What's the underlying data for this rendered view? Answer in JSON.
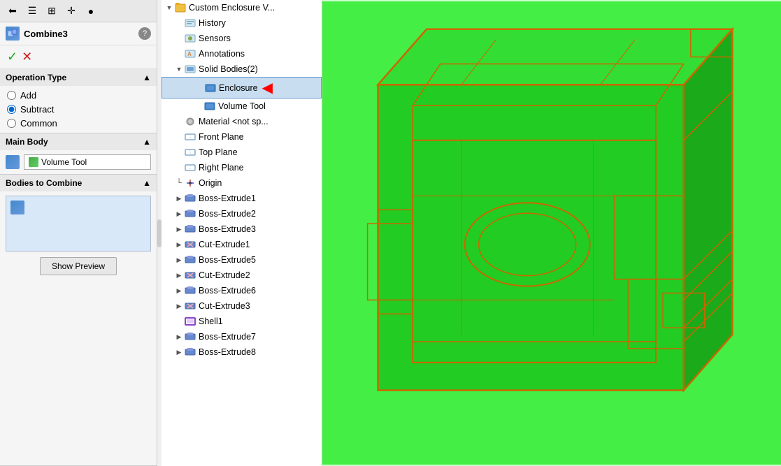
{
  "leftPanel": {
    "toolbar": {
      "buttons": [
        "⬅",
        "☰",
        "⊞",
        "✛",
        "🎨"
      ]
    },
    "combine": {
      "title": "Combine3",
      "help_label": "?",
      "confirm_label": "✓",
      "cancel_label": "✕"
    },
    "operationType": {
      "title": "Operation Type",
      "options": [
        "Add",
        "Subtract",
        "Common"
      ],
      "selected": "Subtract"
    },
    "mainBody": {
      "title": "Main Body",
      "value": "Volume Tool"
    },
    "bodiesToCombine": {
      "title": "Bodies to Combine"
    },
    "showPreview": {
      "label": "Show Preview"
    }
  },
  "tree": {
    "root": "Custom Enclosure V...",
    "items": [
      {
        "id": "history",
        "label": "History",
        "indent": 1,
        "expandable": false,
        "icon": "folder"
      },
      {
        "id": "sensors",
        "label": "Sensors",
        "indent": 1,
        "expandable": false,
        "icon": "sensor"
      },
      {
        "id": "annotations",
        "label": "Annotations",
        "indent": 1,
        "expandable": false,
        "icon": "annotation"
      },
      {
        "id": "solidBodies",
        "label": "Solid Bodies(2)",
        "indent": 1,
        "expandable": true,
        "expanded": true,
        "icon": "folder"
      },
      {
        "id": "enclosure",
        "label": "Enclosure",
        "indent": 2,
        "expandable": false,
        "icon": "body",
        "highlighted": true,
        "hasArrow": true
      },
      {
        "id": "volumeTool",
        "label": "Volume Tool",
        "indent": 2,
        "expandable": false,
        "icon": "body"
      },
      {
        "id": "material",
        "label": "Material <not sp...",
        "indent": 1,
        "expandable": false,
        "icon": "material"
      },
      {
        "id": "frontPlane",
        "label": "Front Plane",
        "indent": 1,
        "expandable": false,
        "icon": "plane"
      },
      {
        "id": "topPlane",
        "label": "Top Plane",
        "indent": 1,
        "expandable": false,
        "icon": "plane"
      },
      {
        "id": "rightPlane",
        "label": "Right Plane",
        "indent": 1,
        "expandable": false,
        "icon": "plane"
      },
      {
        "id": "origin",
        "label": "Origin",
        "indent": 1,
        "expandable": false,
        "icon": "origin"
      },
      {
        "id": "bossExtrude1",
        "label": "Boss-Extrude1",
        "indent": 1,
        "expandable": true,
        "icon": "feature"
      },
      {
        "id": "bossExtrude2",
        "label": "Boss-Extrude2",
        "indent": 1,
        "expandable": true,
        "icon": "feature"
      },
      {
        "id": "bossExtrude3",
        "label": "Boss-Extrude3",
        "indent": 1,
        "expandable": true,
        "icon": "feature"
      },
      {
        "id": "cutExtrude1",
        "label": "Cut-Extrude1",
        "indent": 1,
        "expandable": true,
        "icon": "feature"
      },
      {
        "id": "bossExtrude5",
        "label": "Boss-Extrude5",
        "indent": 1,
        "expandable": true,
        "icon": "feature"
      },
      {
        "id": "cutExtrude2",
        "label": "Cut-Extrude2",
        "indent": 1,
        "expandable": true,
        "icon": "feature"
      },
      {
        "id": "bossExtrude6",
        "label": "Boss-Extrude6",
        "indent": 1,
        "expandable": true,
        "icon": "feature"
      },
      {
        "id": "cutExtrude3",
        "label": "Cut-Extrude3",
        "indent": 1,
        "expandable": true,
        "icon": "feature"
      },
      {
        "id": "shell1",
        "label": "Shell1",
        "indent": 1,
        "expandable": false,
        "icon": "shell"
      },
      {
        "id": "bossExtrude7",
        "label": "Boss-Extrude7",
        "indent": 1,
        "expandable": true,
        "icon": "feature"
      },
      {
        "id": "bossExtrude8",
        "label": "Boss-Extrude8",
        "indent": 1,
        "expandable": true,
        "icon": "feature"
      }
    ]
  },
  "viewport": {
    "background": "#44ff44"
  }
}
